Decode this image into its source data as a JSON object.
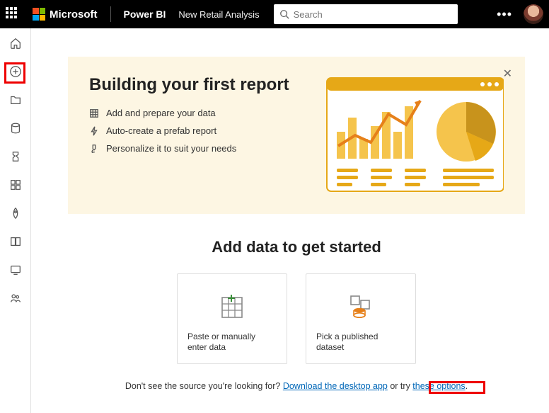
{
  "header": {
    "microsoft": "Microsoft",
    "brand": "Power BI",
    "workspace": "New Retail Analysis",
    "search_placeholder": "Search"
  },
  "rail": {
    "items": [
      {
        "name": "home-icon"
      },
      {
        "name": "create-icon"
      },
      {
        "name": "browse-icon"
      },
      {
        "name": "data-hub-icon"
      },
      {
        "name": "metrics-icon"
      },
      {
        "name": "apps-icon"
      },
      {
        "name": "deployment-icon"
      },
      {
        "name": "learn-icon"
      },
      {
        "name": "monitor-icon"
      },
      {
        "name": "workspaces-icon"
      }
    ]
  },
  "hero": {
    "title": "Building your first report",
    "steps": [
      "Add and prepare your data",
      "Auto-create a prefab report",
      "Personalize it to suit your needs"
    ]
  },
  "section": {
    "title": "Add data to get started"
  },
  "cards": [
    {
      "label": "Paste or manually enter data"
    },
    {
      "label": "Pick a published dataset"
    }
  ],
  "footer": {
    "prefix": "Don't see the source you're looking for?  ",
    "link1": "Download the desktop app",
    "middle": "  or try ",
    "link2": "these options",
    "suffix": "."
  }
}
